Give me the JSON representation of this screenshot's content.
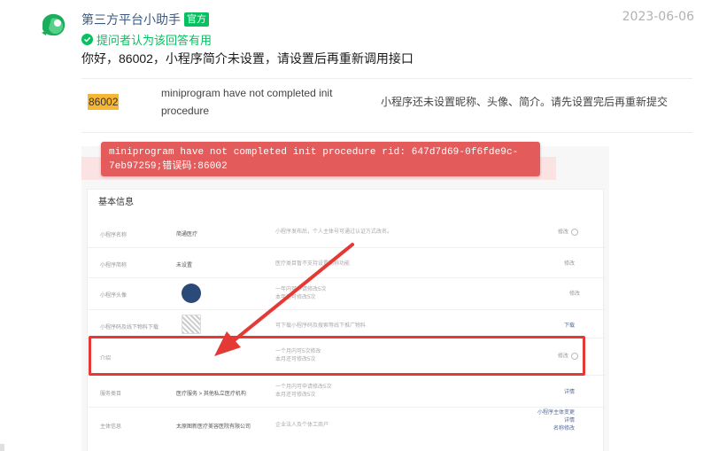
{
  "post": {
    "author": "第三方平台小助手",
    "badge": "官方",
    "date": "2023-06-06",
    "helpful_text": "提问者认为该回答有用",
    "answer_text": "你好，86002，小程序简介未设置，请设置后再重新调用接口"
  },
  "error_row": {
    "code": "86002",
    "message_en": "miniprogram have not completed init procedure",
    "message_zh": "小程序还未设置昵称、头像、简介。请先设置完后再重新提交"
  },
  "toast": {
    "text": "miniprogram have not completed init procedure rid: 647d7d69-0f6fde9c-7eb97259;错误码:86002"
  },
  "panel": {
    "title": "基本信息",
    "rows": [
      {
        "label": "小程序名称",
        "value": "简通医疗",
        "desc": "小程序发布后，个人主体号可通过认证方式改名。",
        "action": "修改"
      },
      {
        "label": "小程序简称",
        "value": "未设置",
        "desc": "医疗类目暂不支持设置简称功能",
        "action": "修改"
      },
      {
        "label": "小程序头像",
        "value": "",
        "desc": "一年内可申请修改5次\n本年还可修改5次",
        "action": "修改"
      },
      {
        "label": "小程序码及线下物料下载",
        "value": "",
        "desc": "可下载小程序码及搜索等线下推广物料",
        "action": "下载"
      },
      {
        "label": "介绍",
        "value": "",
        "desc": "一个月内可5次修改\n本月还可修改5次",
        "action": "修改"
      },
      {
        "label": "服务类目",
        "value": "医疗服务 > 其他私立医疗机构",
        "desc": "一个月内可申请修改5次\n本月还可修改5次",
        "action": "详情"
      },
      {
        "label": "主体信息",
        "value": "太原图新医疗美容医院有限公司",
        "desc": "企业法人及个体工商户",
        "action": "小程序主体变更\n详情\n名称修改"
      }
    ]
  },
  "colors": {
    "brand_green": "#07c160",
    "toast_red": "#e35b5b",
    "highlight_red": "#e53935",
    "code_highlight": "#f7b733"
  }
}
